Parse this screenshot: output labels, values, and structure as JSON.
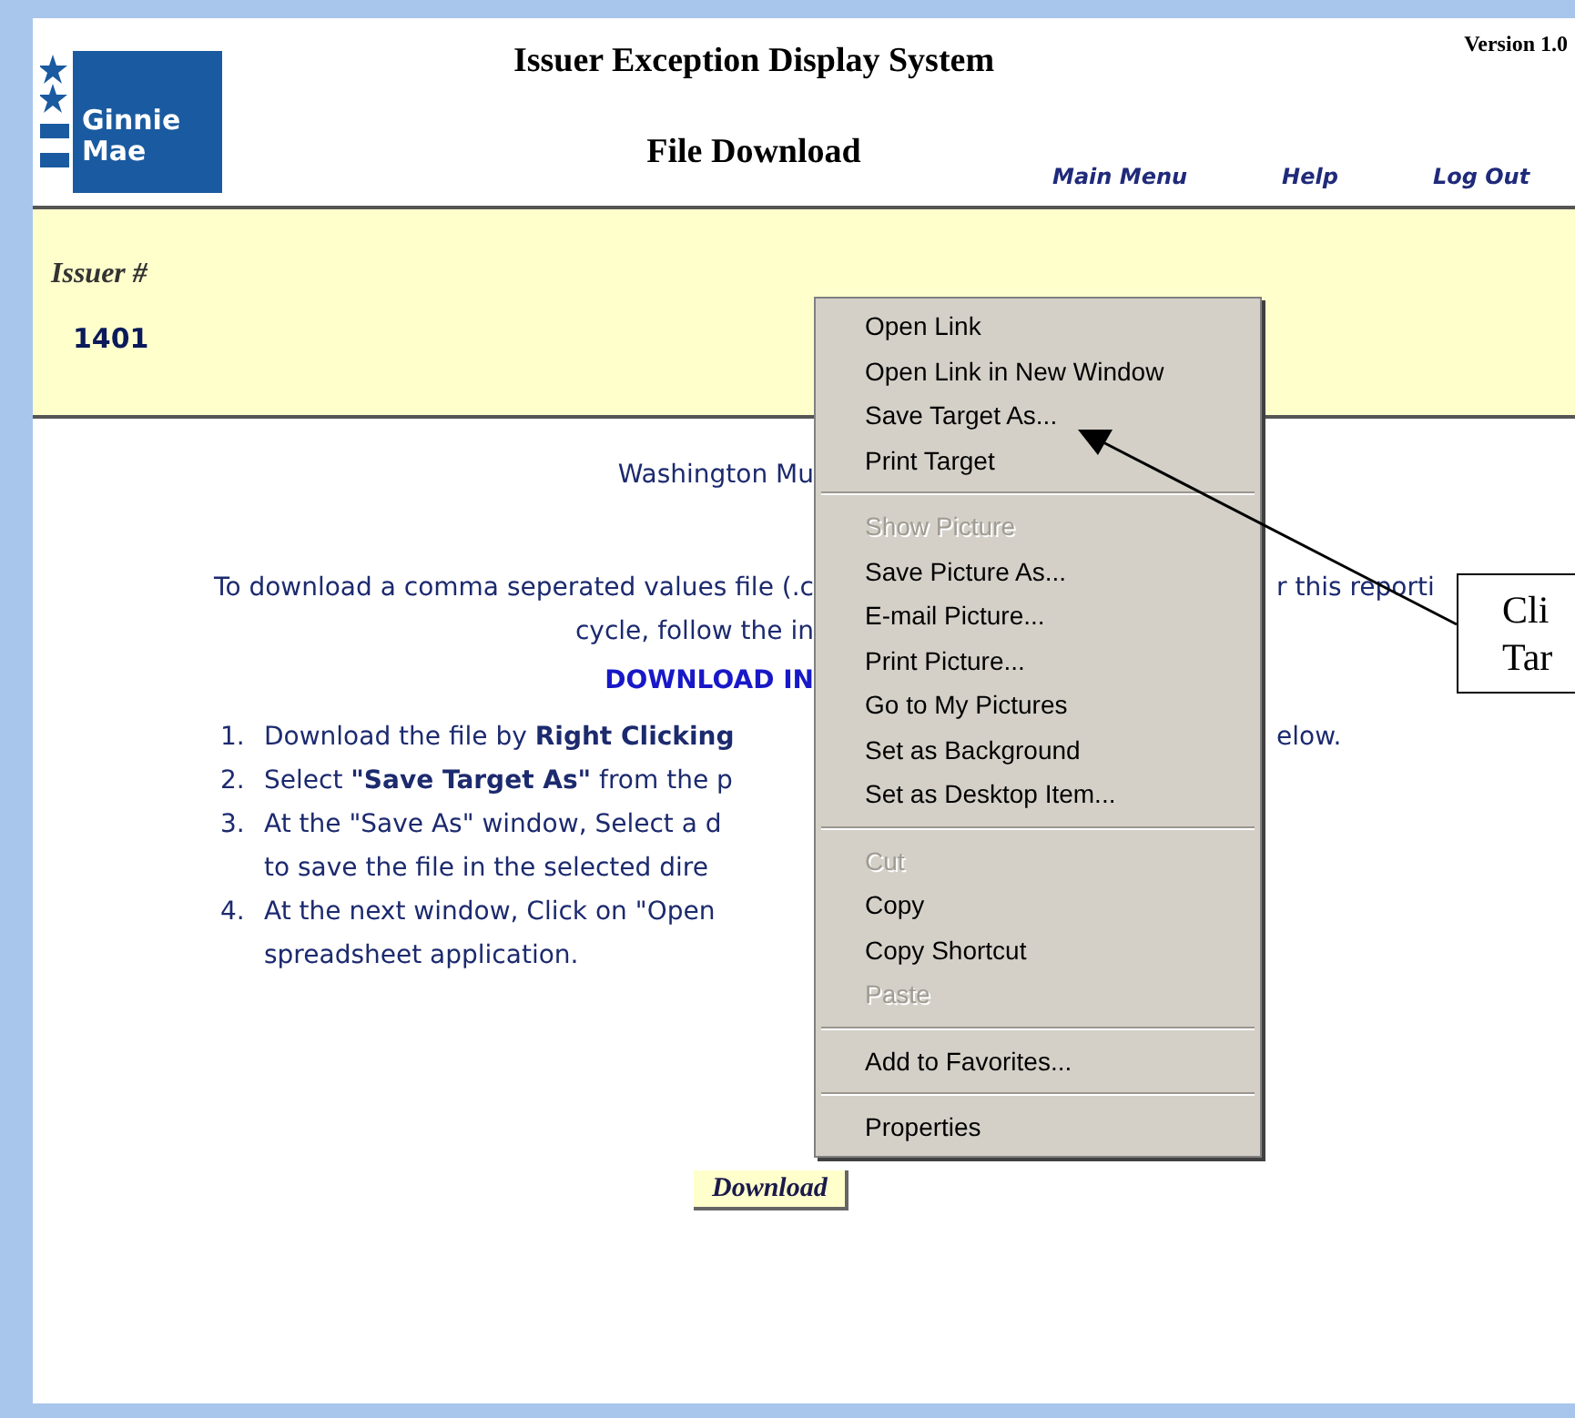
{
  "logo": {
    "lines": [
      "Ginnie",
      "Mae"
    ]
  },
  "header": {
    "title": "Issuer Exception Display System",
    "subtitle": "File Download",
    "version": "Version 1.0",
    "nav": [
      "Main Menu",
      "Help",
      "Log Out"
    ]
  },
  "issuer": {
    "label": "Issuer #",
    "value": "1401"
  },
  "body": {
    "lines": [
      {
        "left": "Washington Mu"
      },
      {
        "left": "To download a comma seperated values file (.c",
        "right": "r this reporti"
      },
      {
        "left": "cycle, follow the in"
      }
    ],
    "heading": "DOWNLOAD IN",
    "instructions": [
      {
        "number": "1.",
        "text": "Download the file by **Right Clicking**",
        "right": "elow."
      },
      {
        "number": "2.",
        "text": "Select **\"Save Target As\"** from the p"
      },
      {
        "number": "3.",
        "text": "At the \"Save As\" window, Select a d",
        "continuation": "to save the file in the selected dire"
      },
      {
        "number": "4.",
        "text": "At the next window, Click on \"Open",
        "continuation": "spreadsheet application."
      }
    ],
    "button": "Download"
  },
  "context_menu": [
    {
      "kind": "item",
      "label": "Open Link",
      "disabled": false
    },
    {
      "kind": "item",
      "label": "Open Link in New Window",
      "disabled": false
    },
    {
      "kind": "item",
      "label": "Save Target As...",
      "disabled": false
    },
    {
      "kind": "item",
      "label": "Print Target",
      "disabled": false
    },
    {
      "kind": "separator"
    },
    {
      "kind": "item",
      "label": "Show Picture",
      "disabled": true
    },
    {
      "kind": "item",
      "label": "Save Picture As...",
      "disabled": false
    },
    {
      "kind": "item",
      "label": "E-mail Picture...",
      "disabled": false
    },
    {
      "kind": "item",
      "label": "Print Picture...",
      "disabled": false
    },
    {
      "kind": "item",
      "label": "Go to My Pictures",
      "disabled": false
    },
    {
      "kind": "item",
      "label": "Set as Background",
      "disabled": false
    },
    {
      "kind": "item",
      "label": "Set as Desktop Item...",
      "disabled": false
    },
    {
      "kind": "separator"
    },
    {
      "kind": "item",
      "label": "Cut",
      "disabled": true
    },
    {
      "kind": "item",
      "label": "Copy",
      "disabled": false
    },
    {
      "kind": "item",
      "label": "Copy Shortcut",
      "disabled": false
    },
    {
      "kind": "item",
      "label": "Paste",
      "disabled": true
    },
    {
      "kind": "separator"
    },
    {
      "kind": "item",
      "label": "Add to Favorites...",
      "disabled": false
    },
    {
      "kind": "separator"
    },
    {
      "kind": "item",
      "label": "Properties",
      "disabled": false
    }
  ],
  "callout": {
    "lines": [
      "Cli",
      "Tar"
    ]
  }
}
